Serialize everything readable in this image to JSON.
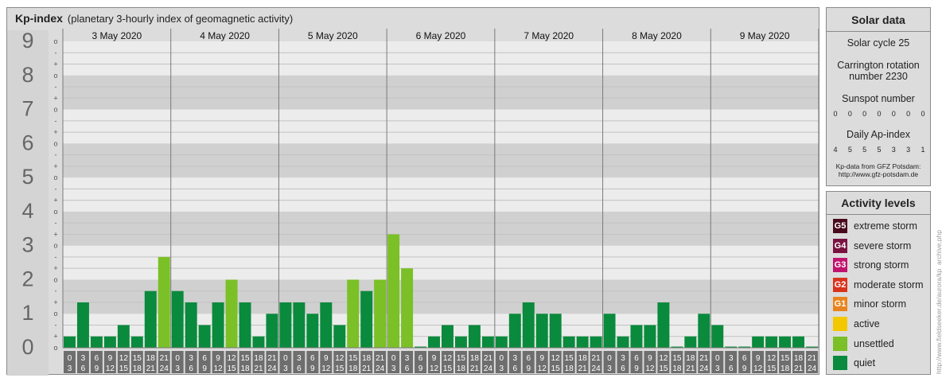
{
  "header": {
    "title": "Kp-index",
    "subtitle": "(planetary 3-hourly index of geomagnetic activity)"
  },
  "chart_data": {
    "type": "bar",
    "ylim": [
      0,
      9
    ],
    "y_ticks": [
      "0",
      "1",
      "2",
      "3",
      "4",
      "5",
      "6",
      "7",
      "8",
      "9"
    ],
    "sub_ticks": [
      "o",
      "+",
      "-",
      "o",
      "+",
      "-",
      "o",
      "+",
      "-",
      "o",
      "+",
      "-",
      "o",
      "+",
      "-",
      "o",
      "+",
      "-",
      "o",
      "+",
      "-",
      "o",
      "+",
      "-",
      "o",
      "+",
      "-",
      "o"
    ],
    "days": [
      "3 May 2020",
      "4 May 2020",
      "5 May 2020",
      "6 May 2020",
      "7 May 2020",
      "8 May 2020",
      "9 May 2020"
    ],
    "interval_top": [
      "0",
      "3",
      "6",
      "9",
      "12",
      "15",
      "18",
      "21"
    ],
    "interval_bottom": [
      "3",
      "6",
      "9",
      "12",
      "15",
      "18",
      "21",
      "24"
    ],
    "values": [
      [
        0.333,
        1.333,
        0.333,
        0.333,
        0.667,
        0.333,
        1.667,
        2.667
      ],
      [
        1.667,
        1.333,
        0.667,
        1.333,
        2.0,
        1.333,
        0.333,
        1.0
      ],
      [
        1.333,
        1.333,
        1.0,
        1.333,
        0.667,
        2.0,
        1.667,
        2.0
      ],
      [
        3.333,
        2.333,
        0.0,
        0.333,
        0.667,
        0.333,
        0.667,
        0.333
      ],
      [
        0.333,
        1.0,
        1.333,
        1.0,
        1.0,
        0.333,
        0.333,
        0.333
      ],
      [
        1.0,
        0.333,
        0.667,
        0.667,
        1.333,
        0.0,
        0.333,
        1.0
      ],
      [
        0.667,
        0.0,
        0.0,
        0.333,
        0.333,
        0.333,
        0.333,
        0.0
      ]
    ],
    "color_quiet": "#0a8a3c",
    "color_unsettled": "#7ac026"
  },
  "solar": {
    "heading": "Solar data",
    "cycle": "Solar cycle 25",
    "carrington_line1": "Carrington rotation",
    "carrington_line2": "number 2230",
    "sunspot_label": "Sunspot number",
    "sunspot_values": [
      "0",
      "0",
      "0",
      "0",
      "0",
      "0",
      "0"
    ],
    "ap_label": "Daily Ap-index",
    "ap_values": [
      "4",
      "5",
      "5",
      "5",
      "3",
      "3",
      "1"
    ],
    "source_line1": "Kp-data from GFZ Potsdam:",
    "source_line2": "http://www.gfz-potsdam.de"
  },
  "activity": {
    "heading": "Activity levels",
    "items": [
      {
        "badge": "G5",
        "label": "extreme storm",
        "color": "#4a0a1e"
      },
      {
        "badge": "G4",
        "label": "severe storm",
        "color": "#7a1240"
      },
      {
        "badge": "G3",
        "label": "strong storm",
        "color": "#c0146e"
      },
      {
        "badge": "G2",
        "label": "moderate storm",
        "color": "#d8341c"
      },
      {
        "badge": "G1",
        "label": "minor storm",
        "color": "#e8841e"
      },
      {
        "badge": "",
        "label": "active",
        "color": "#f4c800"
      },
      {
        "badge": "",
        "label": "unsettled",
        "color": "#7ac026"
      },
      {
        "badge": "",
        "label": "quiet",
        "color": "#0a8a3c"
      }
    ]
  },
  "credit": "http://www.fieldseeker.de/aurora/kp_archive.php"
}
